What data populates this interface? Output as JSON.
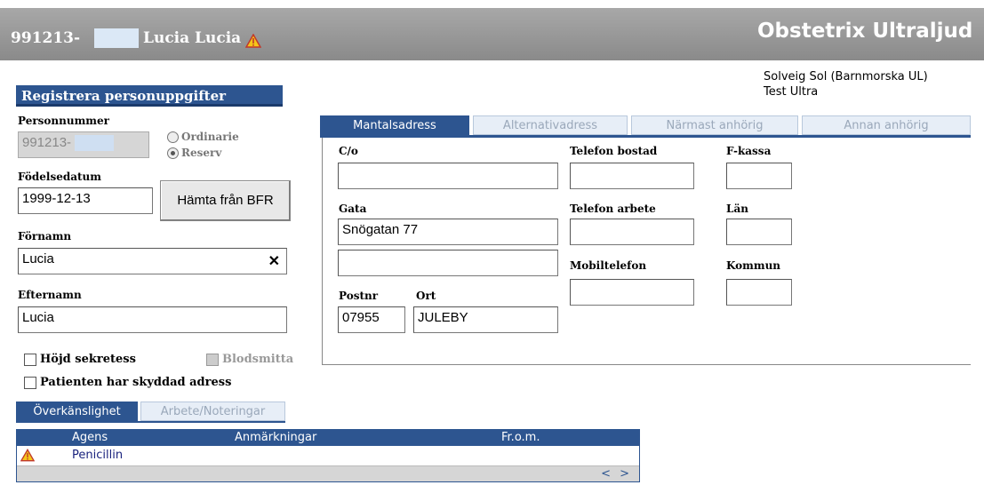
{
  "header": {
    "patient_id": "991213-",
    "patient_name": "Lucia Lucia",
    "app_title": "Obstetrix Ultraljud",
    "bg_color": "#8f8f8f"
  },
  "user": {
    "line1": "Solveig Sol (Barnmorska UL)",
    "line2": "Test Ultra"
  },
  "form": {
    "section_title": "Registrera personuppgifter",
    "personnummer_label": "Personnummer",
    "personnummer_value": "991213-",
    "radio_ordinarie": "Ordinarie",
    "radio_reserv": "Reserv",
    "fodelsedatum_label": "Födelsedatum",
    "fodelsedatum_value": "1999-12-13",
    "hamta_button": "Hämta från BFR",
    "fornamn_label": "Förnamn",
    "fornamn_value": "Lucia",
    "clear_glyph": "✕",
    "efternamn_label": "Efternamn",
    "efternamn_value": "Lucia",
    "hojd_sekretess": "Höjd sekretess",
    "blodsmitta": "Blodsmitta",
    "skyddad_adress": "Patienten har skyddad adress"
  },
  "tabs": [
    {
      "label": "Mantalsadress",
      "active": true
    },
    {
      "label": "Alternativadress",
      "active": false
    },
    {
      "label": "Närmast anhörig",
      "active": false
    },
    {
      "label": "Annan anhörig",
      "active": false
    }
  ],
  "address": {
    "co_label": "C/o",
    "co_value": "",
    "gata_label": "Gata",
    "gata_value": "Snögatan 77",
    "gata2_value": "",
    "postnr_label": "Postnr",
    "postnr_value": "07955",
    "ort_label": "Ort",
    "ort_value": "JULEBY",
    "tel_bostad_label": "Telefon bostad",
    "tel_arbete_label": "Telefon arbete",
    "mobil_label": "Mobiltelefon",
    "fkassa_label": "F-kassa",
    "lan_label": "Län",
    "kommun_label": "Kommun"
  },
  "bottom_tabs": [
    {
      "label": "Överkänslighet",
      "active": true
    },
    {
      "label": "Arbete/Noteringar",
      "active": false
    }
  ],
  "allergy_table": {
    "columns": [
      "Agens",
      "Anmärkningar",
      "Fr.o.m."
    ],
    "rows": [
      {
        "agens": "Penicillin",
        "anmarkningar": "",
        "from": ""
      }
    ],
    "scroll_arrows": "< >"
  },
  "icons": {
    "warning": "warning-triangle-icon"
  }
}
